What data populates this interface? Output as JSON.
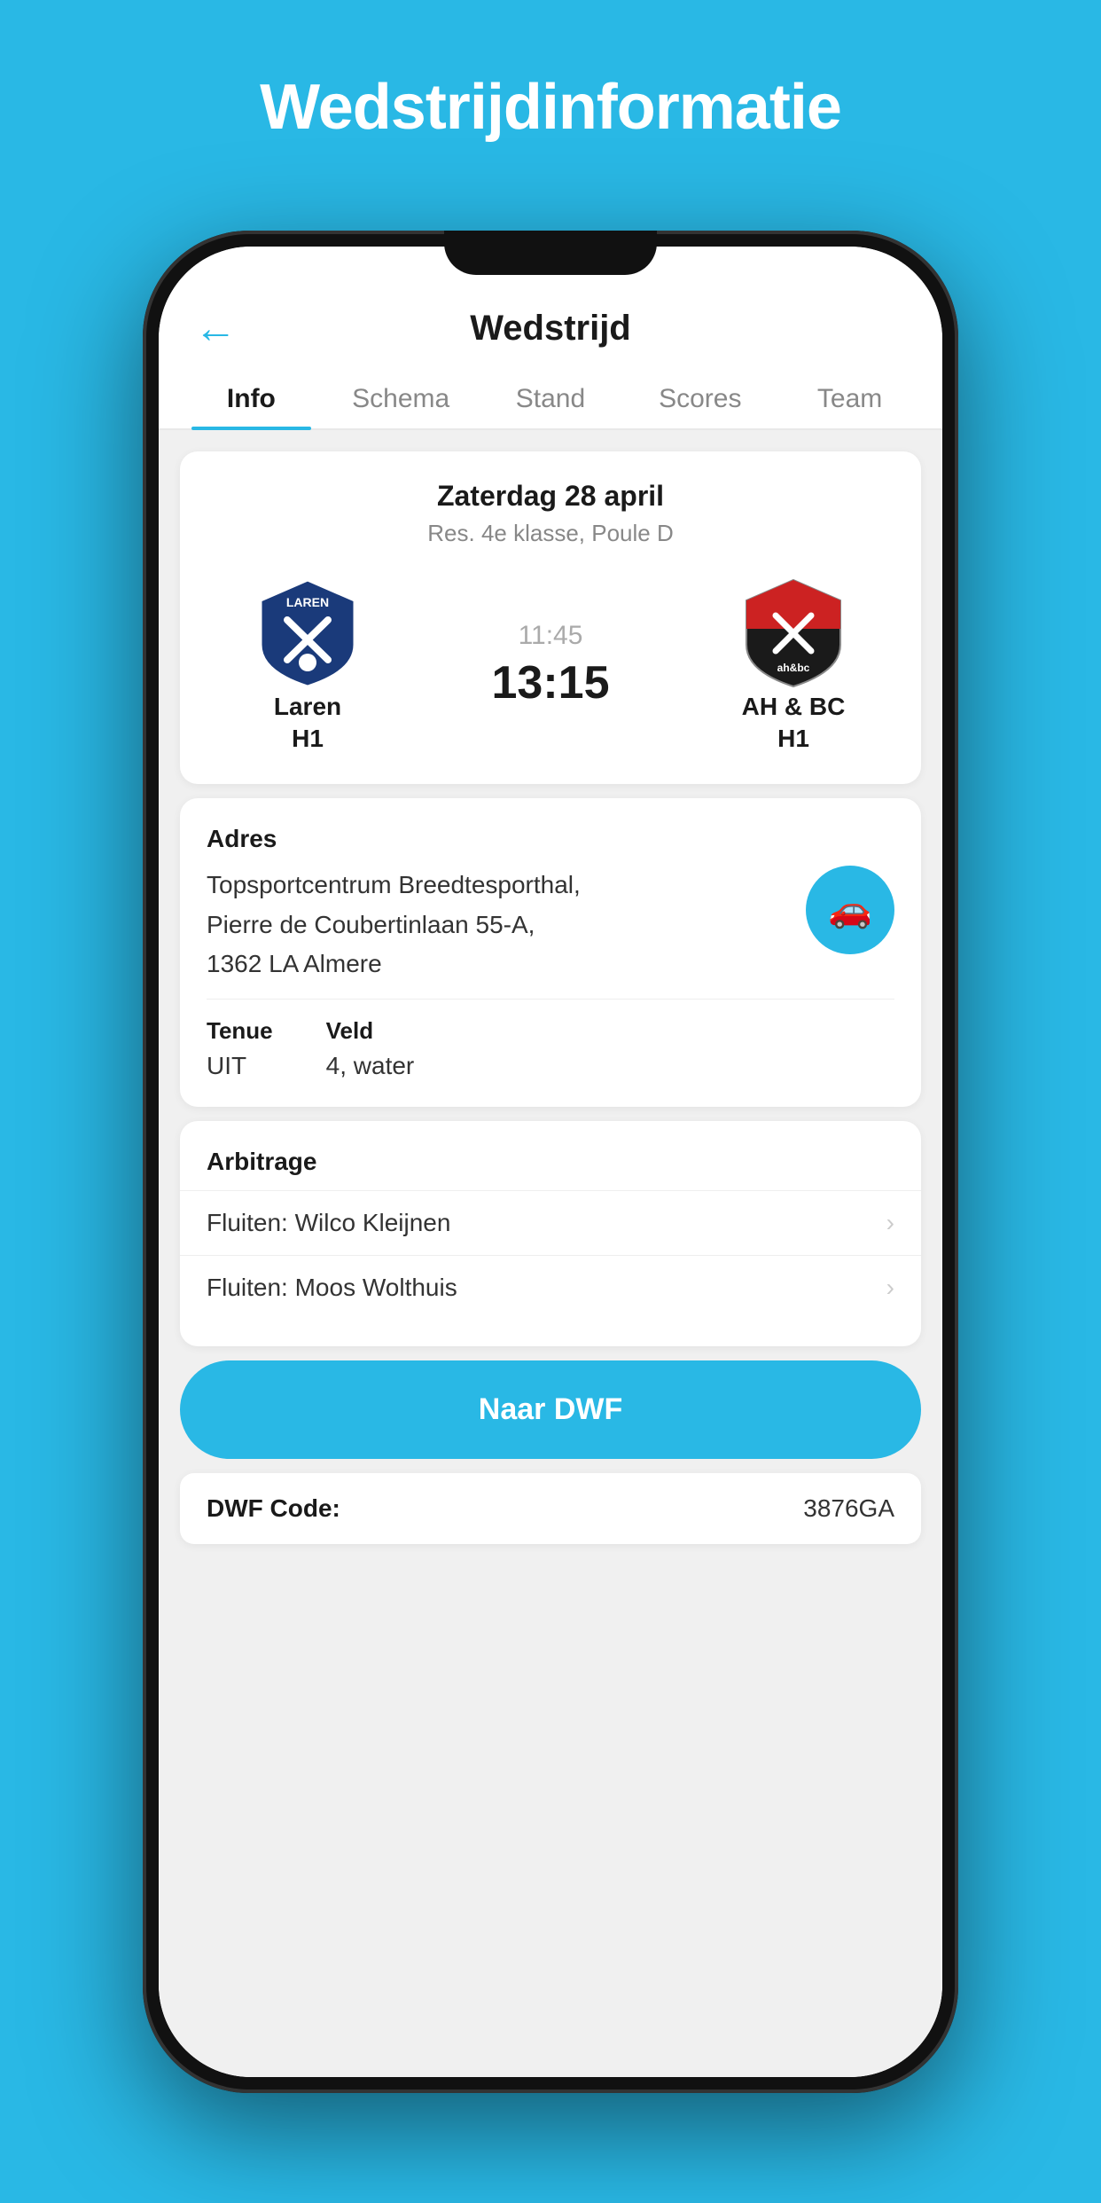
{
  "page": {
    "background_title": "Wedstrijdinformatie",
    "header": {
      "back_label": "←",
      "title": "Wedstrijd"
    },
    "tabs": [
      {
        "id": "info",
        "label": "Info",
        "active": true
      },
      {
        "id": "schema",
        "label": "Schema",
        "active": false
      },
      {
        "id": "stand",
        "label": "Stand",
        "active": false
      },
      {
        "id": "scores",
        "label": "Scores",
        "active": false
      },
      {
        "id": "team",
        "label": "Team",
        "active": false
      }
    ],
    "match": {
      "date": "Zaterdag 28 april",
      "class": "Res. 4e klasse, Poule D",
      "time": "11:45",
      "score": "13:15",
      "home_team": {
        "name": "Laren",
        "sub": "H1"
      },
      "away_team": {
        "name": "AH & BC",
        "sub": "H1"
      }
    },
    "address_section": {
      "label": "Adres",
      "address": "Topsportcentrum Breedtesporthal,\nPierre de Coubertinlaan 55-A,\n1362 LA Almere",
      "nav_button_label": "🚗"
    },
    "tenue": {
      "label": "Tenue",
      "value": "UIT"
    },
    "veld": {
      "label": "Veld",
      "value": "4, water"
    },
    "arbitrage": {
      "label": "Arbitrage",
      "items": [
        {
          "label": "Fluiten: Wilco Kleijnen"
        },
        {
          "label": "Fluiten: Moos Wolthuis"
        }
      ]
    },
    "dwf_button": "Naar DWF",
    "dwf_code": {
      "label": "DWF Code:",
      "value": "3876GA"
    }
  }
}
